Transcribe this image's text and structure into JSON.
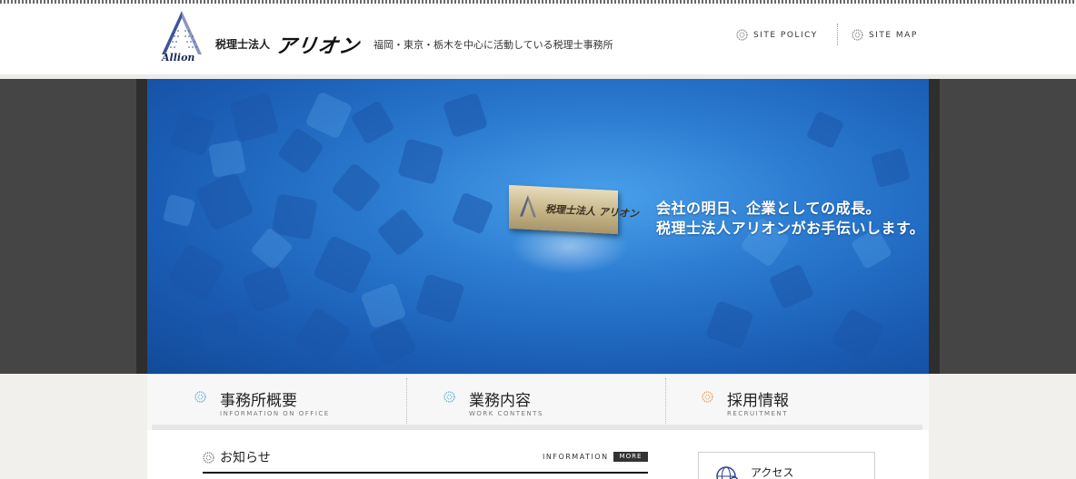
{
  "header": {
    "logo_text": "Allion",
    "firm_prefix": "税理士法人",
    "firm_name": "アリオン",
    "tagline": "福岡・東京・栃木を中心に活動している税理士事務所",
    "links": [
      {
        "label": "SITE POLICY",
        "icon": "globe-bullet-icon"
      },
      {
        "label": "SITE MAP",
        "icon": "globe-bullet-icon"
      }
    ]
  },
  "hero": {
    "plaque_text": "税理士法人 アリオン",
    "copy_line1": "会社の明日、企業としての成長。",
    "copy_line2": "税理士法人アリオンがお手伝いします。"
  },
  "global_nav": [
    {
      "label": "事務所概要",
      "sub": "INFORMATION ON OFFICE",
      "icon": "globe-bullet-icon",
      "icon_color": "#3aa0c8"
    },
    {
      "label": "業務内容",
      "sub": "WORK CONTENTS",
      "icon": "globe-bullet-icon",
      "icon_color": "#3aa0c8"
    },
    {
      "label": "採用情報",
      "sub": "RECRUITMENT",
      "icon": "globe-bullet-icon",
      "icon_color": "#e08a3a"
    }
  ],
  "news": {
    "title": "お知らせ",
    "title_en": "INFORMATION",
    "more_label": "MORE"
  },
  "sidebar": {
    "access_label": "アクセス",
    "access_icon": "globe-magnifier-icon"
  },
  "colors": {
    "hero_blue": "#2a7ad0",
    "nav_icon_blue": "#3aa0c8",
    "nav_icon_orange": "#e08a3a",
    "frame_dark": "#454545"
  }
}
